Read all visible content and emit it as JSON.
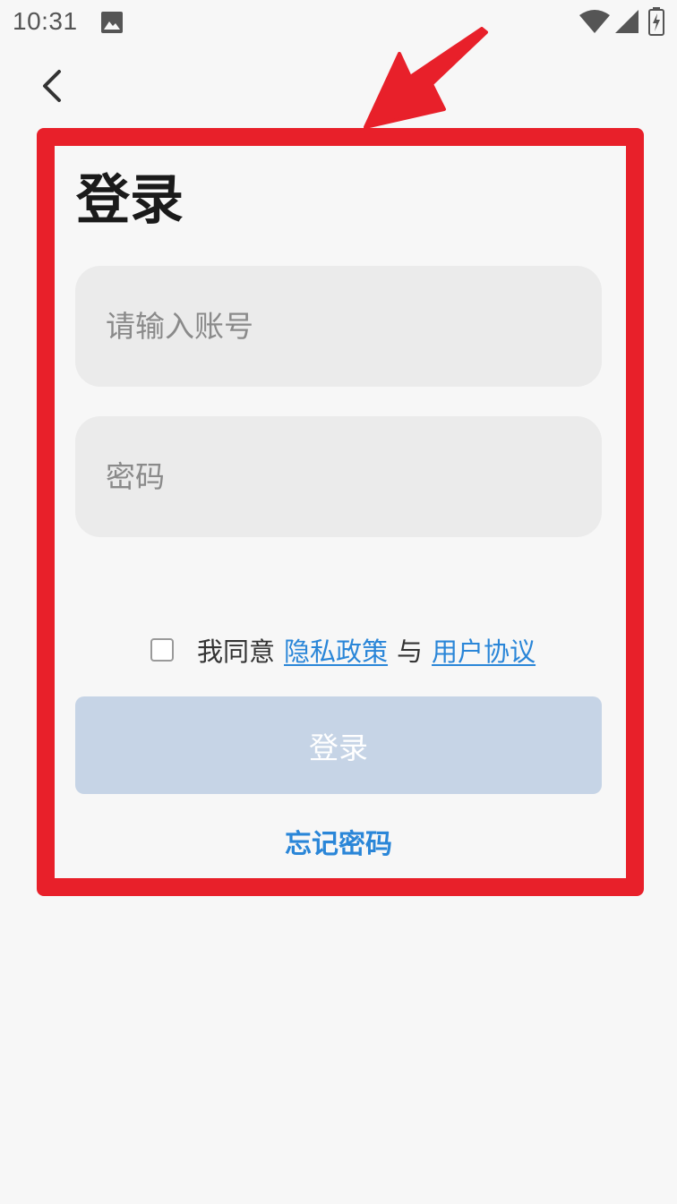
{
  "status_bar": {
    "time": "10:31",
    "icons": [
      "image-icon",
      "wifi-icon",
      "signal-icon",
      "battery-charging-icon"
    ]
  },
  "nav": {
    "back_icon": "chevron-left-icon"
  },
  "login": {
    "title": "登录",
    "account_placeholder": "请输入账号",
    "account_value": "",
    "password_placeholder": "密码",
    "password_value": "",
    "agreement": {
      "checked": false,
      "prefix": "我同意",
      "privacy_link": "隐私政策",
      "conjunction": "与",
      "terms_link": "用户协议"
    },
    "submit_label": "登录",
    "forgot_password": "忘记密码"
  },
  "colors": {
    "background": "#f7f7f7",
    "highlight": "#e8202a",
    "link": "#2a86d8",
    "button_disabled": "#c6d4e6",
    "input_bg": "#ebebeb"
  }
}
